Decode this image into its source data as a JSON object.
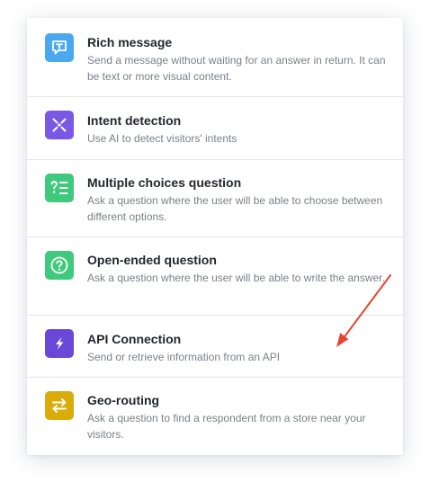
{
  "items": [
    {
      "title": "Rich message",
      "description": "Send a message without waiting for an answer in return. It can be text or more visual content.",
      "icon": "chat-bubble-text-icon",
      "color": "#4aa8f0"
    },
    {
      "title": "Intent detection",
      "description": "Use AI to detect visitors' intents",
      "icon": "intent-nodes-icon",
      "color": "#7b57e6"
    },
    {
      "title": "Multiple choices question",
      "description": "Ask a question where the user will be able to choose between different options.",
      "icon": "question-list-icon",
      "color": "#3ec97c"
    },
    {
      "title": "Open-ended question",
      "description": "Ask a question where the user will be able to write the answer.",
      "icon": "question-circle-icon",
      "color": "#3ec97c"
    },
    {
      "title": "API Connection",
      "description": "Send or retrieve information from an API",
      "icon": "lightning-icon",
      "color": "#6a47d6"
    },
    {
      "title": "Geo-routing",
      "description": "Ask a question to find a respondent from a store near your visitors.",
      "icon": "swap-arrows-icon",
      "color": "#d9ac0c"
    }
  ],
  "annotation": {
    "arrow_color": "#e8442c"
  }
}
